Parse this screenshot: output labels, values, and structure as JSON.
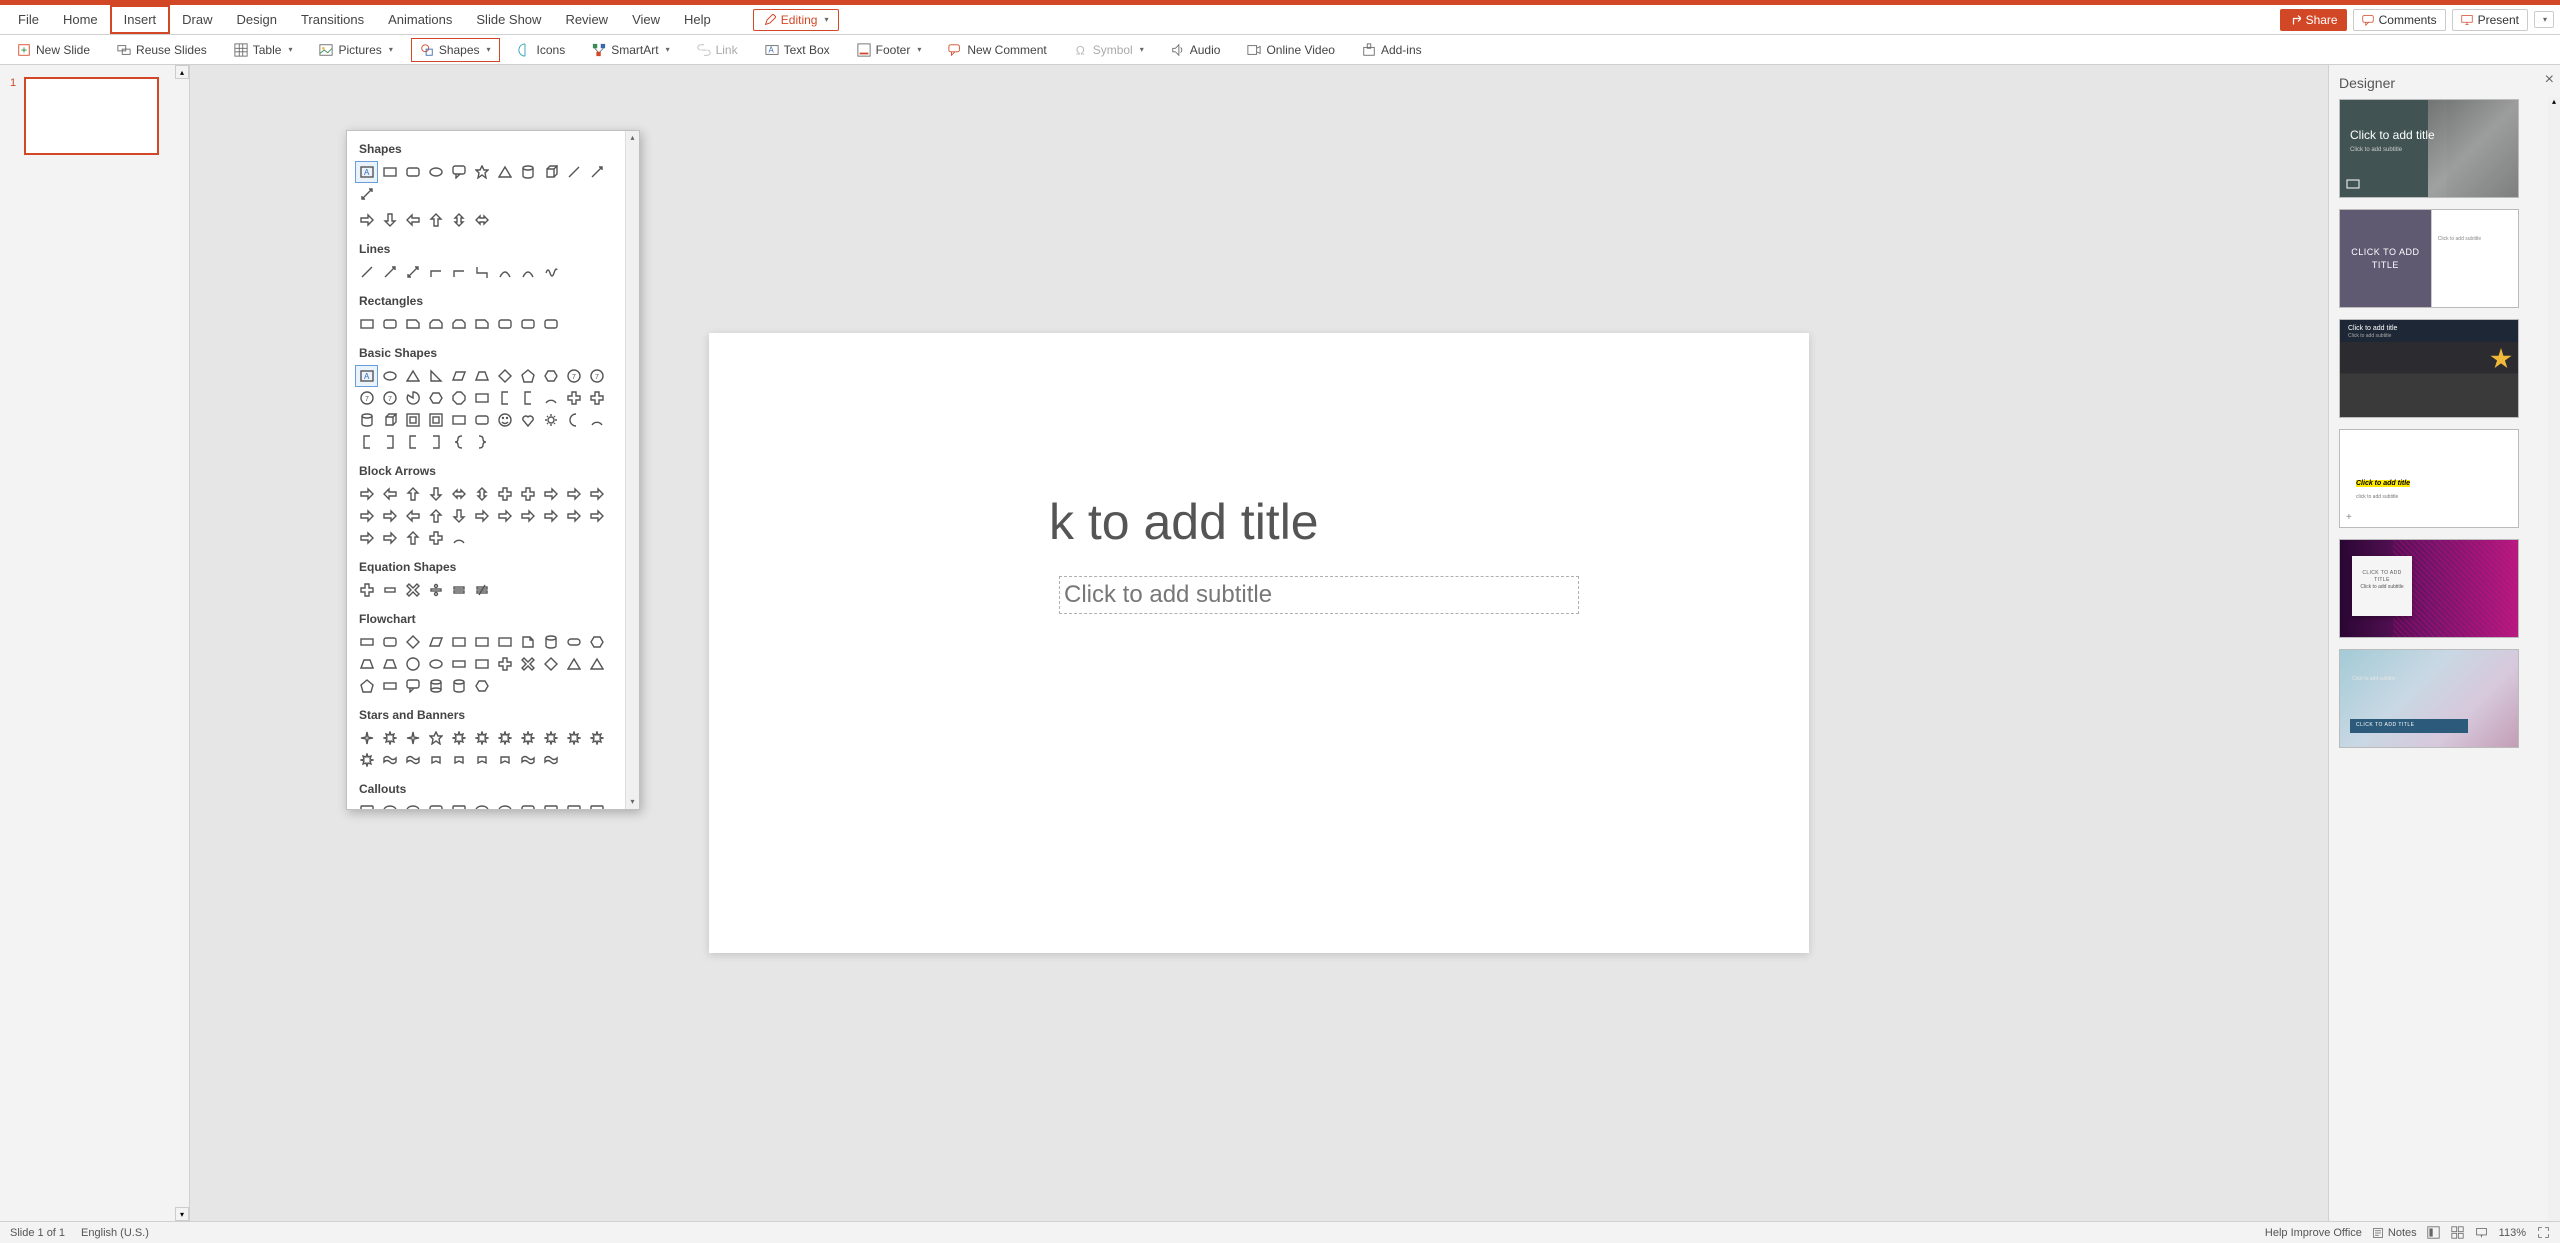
{
  "menu": {
    "items": [
      "File",
      "Home",
      "Insert",
      "Draw",
      "Design",
      "Transitions",
      "Animations",
      "Slide Show",
      "Review",
      "View",
      "Help"
    ],
    "active": "Insert",
    "editing": "Editing",
    "share": "Share",
    "comments": "Comments",
    "present": "Present"
  },
  "ribbon": {
    "new_slide": "New Slide",
    "reuse_slides": "Reuse Slides",
    "table": "Table",
    "pictures": "Pictures",
    "shapes": "Shapes",
    "icons": "Icons",
    "smartart": "SmartArt",
    "link": "Link",
    "text_box": "Text Box",
    "footer": "Footer",
    "new_comment": "New Comment",
    "symbol": "Symbol",
    "audio": "Audio",
    "online_video": "Online Video",
    "addins": "Add-ins"
  },
  "thumbs": {
    "num": "1"
  },
  "slide": {
    "title_ph": "k to add title",
    "subtitle_ph": "Click to add subtitle"
  },
  "shapes_panel": {
    "cat_shapes": "Shapes",
    "cat_lines": "Lines",
    "cat_rectangles": "Rectangles",
    "cat_basic": "Basic Shapes",
    "cat_block_arrows": "Block Arrows",
    "cat_equation": "Equation Shapes",
    "cat_flowchart": "Flowchart",
    "cat_stars": "Stars and Banners",
    "cat_callouts": "Callouts"
  },
  "designer": {
    "title": "Designer",
    "d1_t": "Click to add title",
    "d1_s": "Click to add subtitle",
    "d2_t": "CLICK TO ADD TITLE",
    "d2_s": "Click to add subtitle",
    "d3_t": "Click to add title",
    "d3_s": "Click to add subtitle",
    "d4_t": "Click to add title",
    "d4_s": "click to add subtitle",
    "d5_t": "CLICK TO ADD TITLE",
    "d5_s": "Click to add subtitle",
    "d6_t": "CLICK TO ADD TITLE",
    "d6_s": "Click to add subtitle"
  },
  "status": {
    "slide": "Slide 1 of 1",
    "lang": "English (U.S.)",
    "help": "Help Improve Office",
    "notes": "Notes",
    "zoom": "113%"
  }
}
